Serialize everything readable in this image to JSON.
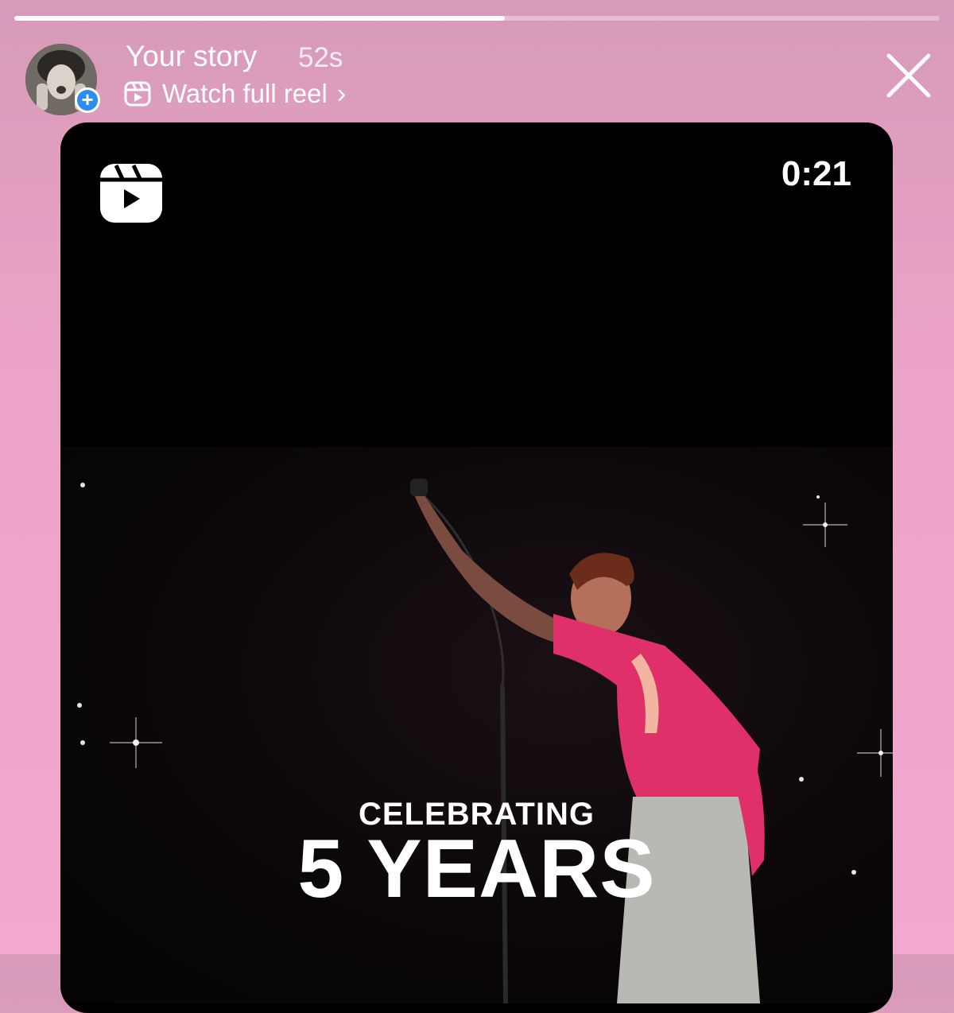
{
  "story": {
    "title": "Your story",
    "age": "52s",
    "progress": 0.53,
    "reel_link_label": "Watch full reel",
    "reel_link_chevron": "›",
    "add_badge": "+"
  },
  "reel": {
    "duration": "0:21",
    "caption_line1": "CELEBRATING",
    "caption_line2": "5 YEARS"
  },
  "icons": {
    "reels": "reels-icon",
    "close": "close-icon",
    "add": "plus-icon",
    "chevron": "chevron-right-icon"
  },
  "colors": {
    "background_top": "#d79ab9",
    "background_bottom": "#f3a8cf",
    "badge": "#2d8cf0",
    "shirt": "#e0306a"
  }
}
